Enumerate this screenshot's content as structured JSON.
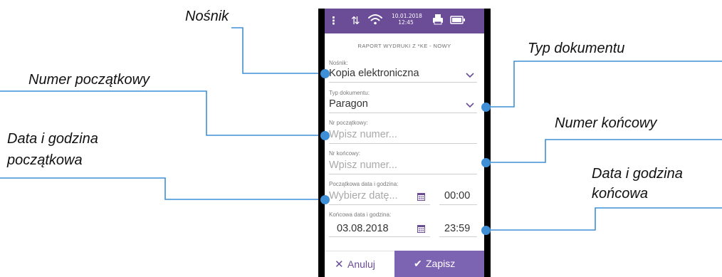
{
  "annotations": {
    "nosnik": "Nośnik",
    "typ_dokumentu": "Typ dokumentu",
    "numer_poczatkowy": "Numer początkowy",
    "numer_koncowy": "Numer końcowy",
    "data_poczatkowa_line1": "Data i godzina",
    "data_poczatkowa_line2": "początkowa",
    "data_koncowa_line1": "Data i godzina",
    "data_koncowa_line2": "końcowa"
  },
  "status_bar": {
    "date": "10.01.2018",
    "time": "12:45",
    "icons": [
      "menu-dots-icon",
      "data-transfer-icon",
      "wifi-icon",
      "printer-icon",
      "battery-icon"
    ]
  },
  "form": {
    "title": "RAPORT WYDRUKI Z *KE - NOWY",
    "nosnik": {
      "label": "Nośnik:",
      "value": "Kopia elektroniczna"
    },
    "typ_dokumentu": {
      "label": "Typ dokumentu:",
      "value": "Paragon"
    },
    "nr_poczatkowy": {
      "label": "Nr początkowy:",
      "placeholder": "Wpisz numer..."
    },
    "nr_koncowy": {
      "label": "Nr końcowy:",
      "placeholder": "Wpisz numer..."
    },
    "data_poczatkowa": {
      "label": "Początkowa data i godzina:",
      "date_placeholder": "Wybierz datę...",
      "time": "00:00"
    },
    "data_koncowa": {
      "label": "Końcowa data i godzina:",
      "date": "03.08.2018",
      "time": "23:59"
    }
  },
  "buttons": {
    "cancel": "Anuluj",
    "save": "Zapisz"
  },
  "colors": {
    "status_bar": "#6a4c97",
    "save_button": "#7d64b3",
    "accent": "#6a4c97",
    "callout_line": "#3f8fd6"
  }
}
